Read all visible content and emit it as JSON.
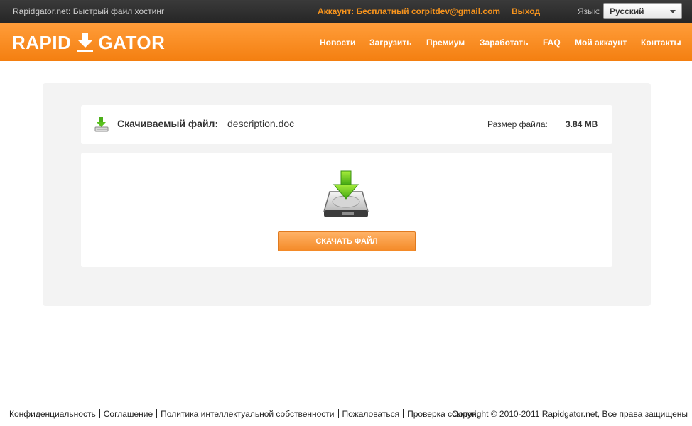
{
  "topbar": {
    "site_title": "Rapidgator.net: Быстрый файл хостинг",
    "account_label": "Аккаунт: Бесплатный",
    "email": "corpitdev@gmail.com",
    "logout_label": "Выход",
    "language_label": "Язык:",
    "language_selected": "Русский"
  },
  "header": {
    "logo_left": "RAPID",
    "logo_right": "GATOR",
    "nav": [
      "Новости",
      "Загрузить",
      "Премиум",
      "Заработать",
      "FAQ",
      "Мой аккаунт",
      "Контакты"
    ]
  },
  "file": {
    "label": "Скачиваемый файл:",
    "name": "description.doc",
    "size_label": "Размер файла:",
    "size_value": "3.84 MB"
  },
  "download": {
    "button_label": "СКАЧАТЬ ФАЙЛ"
  },
  "footer": {
    "links": [
      "Конфиденциальность",
      "Соглашение",
      "Политика интеллектуальной собственности",
      "Пожаловаться",
      "Проверка ссылок"
    ],
    "copyright": "Copyright © 2010-2011 Rapidgator.net, Все права защищены"
  },
  "colors": {
    "brand_orange": "#f7941d",
    "topbar_dark": "#2e2e2e",
    "panel_gray": "#f3f3f3"
  },
  "icons": [
    "download-arrow-icon",
    "hard-drive-download-icon",
    "file-download-icon",
    "chevron-down-icon"
  ]
}
